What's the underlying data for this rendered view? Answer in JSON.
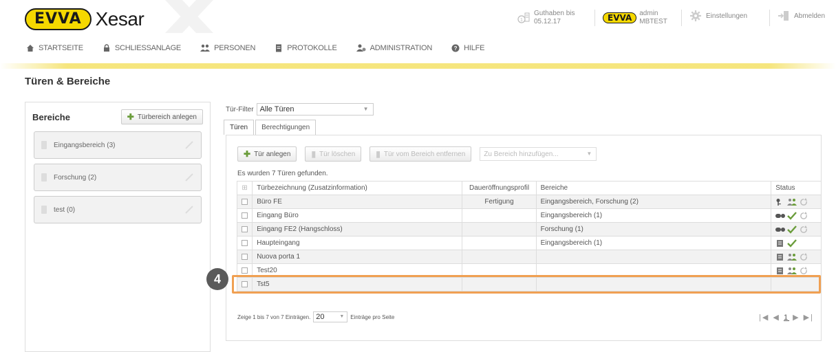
{
  "header": {
    "logo_evva": "EVVA",
    "logo_xesar": "Xesar",
    "credit_label": "Guthaben bis",
    "credit_date": "05.12.17",
    "admin_badge": "EVVA",
    "admin_user": "admin",
    "admin_site": "MBTEST",
    "settings_label": "Einstellungen",
    "logout_label": "Abmelden"
  },
  "nav": {
    "items": [
      {
        "label": "STARTSEITE",
        "icon": "home-icon"
      },
      {
        "label": "SCHLIESSANLAGE",
        "icon": "lock-icon"
      },
      {
        "label": "PERSONEN",
        "icon": "people-icon"
      },
      {
        "label": "PROTOKOLLE",
        "icon": "document-icon"
      },
      {
        "label": "ADMINISTRATION",
        "icon": "admin-icon"
      },
      {
        "label": "HILFE",
        "icon": "help-icon"
      }
    ]
  },
  "page": {
    "title": "Türen & Bereiche"
  },
  "left": {
    "title": "Bereiche",
    "add_button": "Türbereich anlegen",
    "areas": [
      "Eingangsbereich (3)",
      "Forschung (2)",
      "test (0)"
    ]
  },
  "filter": {
    "label": "Tür-Filter",
    "value": "Alle Türen"
  },
  "tabs": [
    "Türen",
    "Berechtigungen"
  ],
  "toolbar": {
    "add": "Tür anlegen",
    "delete": "Tür löschen",
    "remove": "Tür vom Bereich entfernen",
    "add_to_area_placeholder": "Zu Bereich hinzufügen..."
  },
  "found_text": "Es wurden 7 Türen gefunden.",
  "table": {
    "columns": [
      "Türbezeichnung (Zusatzinformation)",
      "Daueröffnungsprofil",
      "Bereiche",
      "Status"
    ],
    "rows": [
      {
        "name": "Büro FE",
        "profile": "Fertigung",
        "areas": "Eingangsbereich, Forschung (2)",
        "status": [
          "key-icon",
          "people-icon",
          "sync-icon"
        ]
      },
      {
        "name": "Eingang Büro",
        "profile": "",
        "areas": "Eingangsbereich (1)",
        "status": [
          "chip-icon",
          "check-icon",
          "sync-icon"
        ]
      },
      {
        "name": "Eingang FE2 (Hangschloss)",
        "profile": "",
        "areas": "Forschung (1)",
        "status": [
          "chip-icon",
          "check-icon",
          "sync-icon"
        ]
      },
      {
        "name": "Haupteingang",
        "profile": "",
        "areas": "Eingangsbereich (1)",
        "status": [
          "task-icon",
          "check-icon"
        ]
      },
      {
        "name": "Nuova porta 1",
        "profile": "",
        "areas": "",
        "status": [
          "task-icon",
          "people-icon",
          "sync-icon"
        ]
      },
      {
        "name": "Test20",
        "profile": "",
        "areas": "",
        "status": [
          "task-icon",
          "people-icon",
          "sync-icon"
        ]
      },
      {
        "name": "Tst5",
        "profile": "",
        "areas": "",
        "status": []
      }
    ]
  },
  "footer": {
    "show_text": "Zeige 1 bis 7 von 7 Einträgen.",
    "per_page": "20",
    "per_page_label": "Einträge pro Seite",
    "pager_first": "|◀",
    "pager_prev": "◀",
    "pager_current": "1",
    "pager_next": "▶",
    "pager_last": "▶|"
  },
  "annotation": {
    "step_number": "4",
    "highlight_color": "#f0a052"
  }
}
